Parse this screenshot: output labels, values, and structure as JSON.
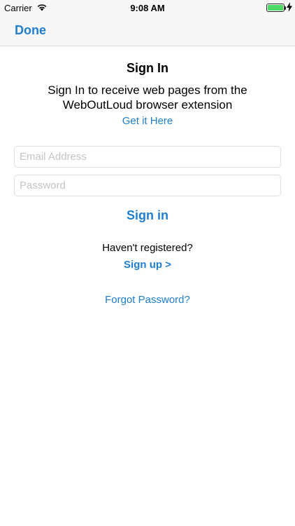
{
  "status_bar": {
    "carrier": "Carrier",
    "time": "9:08 AM",
    "wifi_icon": "wifi-icon",
    "battery_icon": "battery-icon",
    "battery_level": 1.0,
    "battery_color": "#4cd964"
  },
  "nav": {
    "done_label": "Done"
  },
  "main": {
    "title": "Sign In",
    "subtitle": "Sign In to receive web pages from the WebOutLoud browser extension",
    "get_it_label": "Get it Here",
    "email_placeholder": "Email Address",
    "email_value": "",
    "password_placeholder": "Password",
    "password_value": "",
    "sign_in_label": "Sign in",
    "registered_text": "Haven't registered?",
    "sign_up_label": "Sign up >",
    "forgot_label": "Forgot Password?"
  },
  "colors": {
    "accent": "#1f7ed0",
    "placeholder": "#c4c4c9",
    "bar_background": "#f7f7f7"
  }
}
